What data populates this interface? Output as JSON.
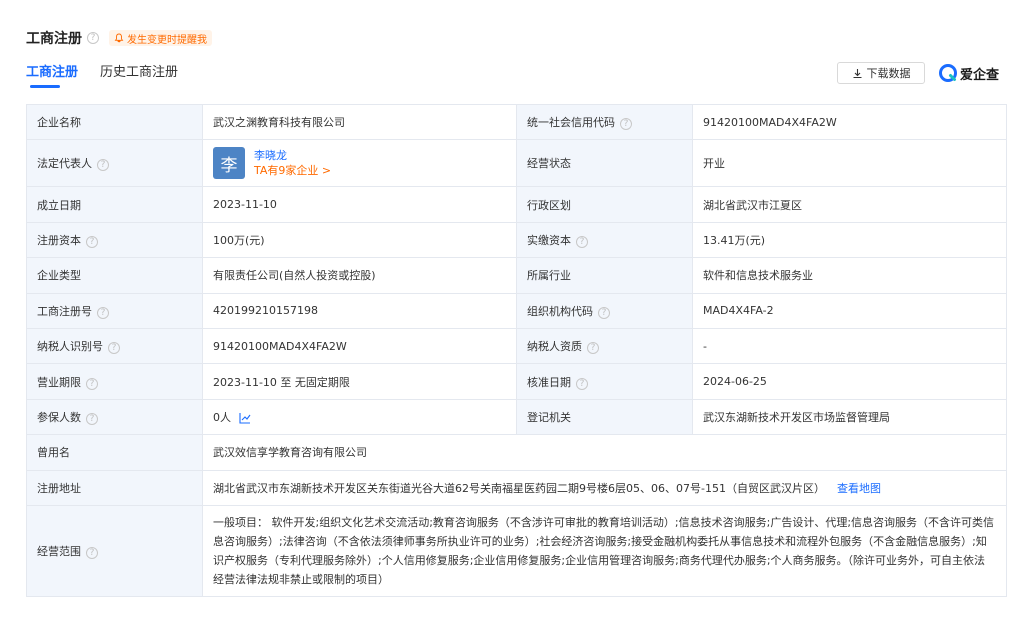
{
  "header": {
    "title": "工商注册",
    "remind_label": "发生变更时提醒我"
  },
  "tabs": [
    {
      "label": "工商注册"
    },
    {
      "label": "历史工商注册"
    }
  ],
  "toolbar": {
    "download_label": "下载数据",
    "brand_label": "爱企查"
  },
  "info": {
    "company_name": {
      "label": "企业名称",
      "value": "武汉之渊教育科技有限公司"
    },
    "credit_code": {
      "label": "统一社会信用代码",
      "value": "91420100MAD4X4FA2W"
    },
    "legal_rep": {
      "label": "法定代表人",
      "avatar_char": "李",
      "name": "李晓龙",
      "sub": "TA有9家企业 >"
    },
    "status": {
      "label": "经营状态",
      "value": "开业"
    },
    "founded": {
      "label": "成立日期",
      "value": "2023-11-10"
    },
    "region": {
      "label": "行政区划",
      "value": "湖北省武汉市江夏区"
    },
    "reg_capital": {
      "label": "注册资本",
      "value": "100万(元)"
    },
    "paid_capital": {
      "label": "实缴资本",
      "value": "13.41万(元)"
    },
    "company_type": {
      "label": "企业类型",
      "value": "有限责任公司(自然人投资或控股)"
    },
    "industry": {
      "label": "所属行业",
      "value": "软件和信息技术服务业"
    },
    "reg_number": {
      "label": "工商注册号",
      "value": "420199210157198"
    },
    "org_code": {
      "label": "组织机构代码",
      "value": "MAD4X4FA-2"
    },
    "taxpayer_id": {
      "label": "纳税人识别号",
      "value": "91420100MAD4X4FA2W"
    },
    "taxpayer_qual": {
      "label": "纳税人资质",
      "value": "-"
    },
    "term": {
      "label": "营业期限",
      "value": "2023-11-10 至 无固定期限"
    },
    "approval_date": {
      "label": "核准日期",
      "value": "2024-06-25"
    },
    "insured": {
      "label": "参保人数",
      "value": "0人"
    },
    "authority": {
      "label": "登记机关",
      "value": "武汉东湖新技术开发区市场监督管理局"
    },
    "former_name": {
      "label": "曾用名",
      "value": "武汉效信享学教育咨询有限公司"
    },
    "address": {
      "label": "注册地址",
      "value": "湖北省武汉市东湖新技术开发区关东街道光谷大道62号关南福星医药园二期9号楼6层05、06、07号-151（自贸区武汉片区）",
      "map_link": "查看地图"
    },
    "scope": {
      "label": "经营范围",
      "value": "一般项目： 软件开发;组织文化艺术交流活动;教育咨询服务（不含涉许可审批的教育培训活动）;信息技术咨询服务;广告设计、代理;信息咨询服务（不含许可类信息咨询服务）;法律咨询（不含依法须律师事务所执业许可的业务）;社会经济咨询服务;接受金融机构委托从事信息技术和流程外包服务（不含金融信息服务）;知识产权服务（专利代理服务除外）;个人信用修复服务;企业信用修复服务;企业信用管理咨询服务;商务代理代办服务;个人商务服务。（除许可业务外，可自主依法经营法律法规非禁止或限制的项目）"
    }
  },
  "colors": {
    "accent": "#1a6cff",
    "orange": "#ff6a00",
    "label_bg": "#f2f6fc",
    "avatar_bg": "#4d84c5"
  }
}
